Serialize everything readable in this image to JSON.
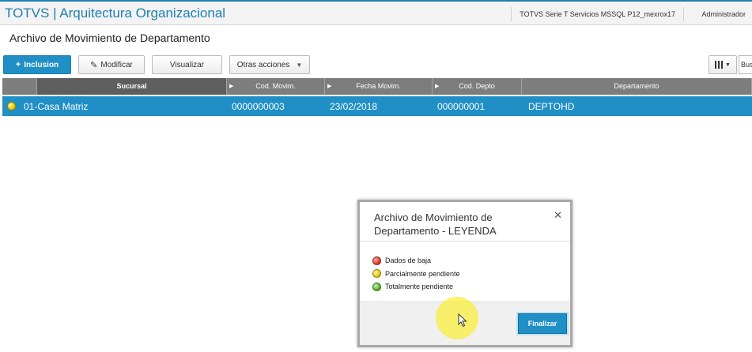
{
  "header": {
    "app_title": "TOTVS | Arquitectura Organizacional",
    "environment": "TOTVS Serie T Servicios MSSQL P12_mexrox17",
    "user": "Administrador"
  },
  "page": {
    "title": "Archivo de Movimiento de Departamento"
  },
  "toolbar": {
    "include_label": "Inclusion",
    "modify_label": "Modificar",
    "view_label": "Visualizar",
    "other_label": "Otras acciones",
    "search_partial": "Bus"
  },
  "grid": {
    "columns": [
      "Sucursal",
      "Cod. Movim.",
      "Fecha Movim.",
      "Cod. Depto",
      "Departamento"
    ],
    "rows": [
      {
        "status": "yellow",
        "sucursal": "01-Casa Matriz",
        "cod_movim": "0000000003",
        "fecha_movim": "23/02/2018",
        "cod_depto": "000000001",
        "departamento": "DEPTOHD"
      }
    ]
  },
  "legend_dialog": {
    "title": "Archivo de Movimiento de Departamento - LEYENDA",
    "items": [
      {
        "color": "red",
        "label": "Dados de baja"
      },
      {
        "color": "yellow",
        "label": "Parcialmente pendiente"
      },
      {
        "color": "green",
        "label": "Totalmente pendiente"
      }
    ],
    "finalize_label": "Finalizar"
  },
  "colors": {
    "accent": "#1f8fc5",
    "brand": "#1f7fb0",
    "grid_header": "#7d7d7d"
  }
}
